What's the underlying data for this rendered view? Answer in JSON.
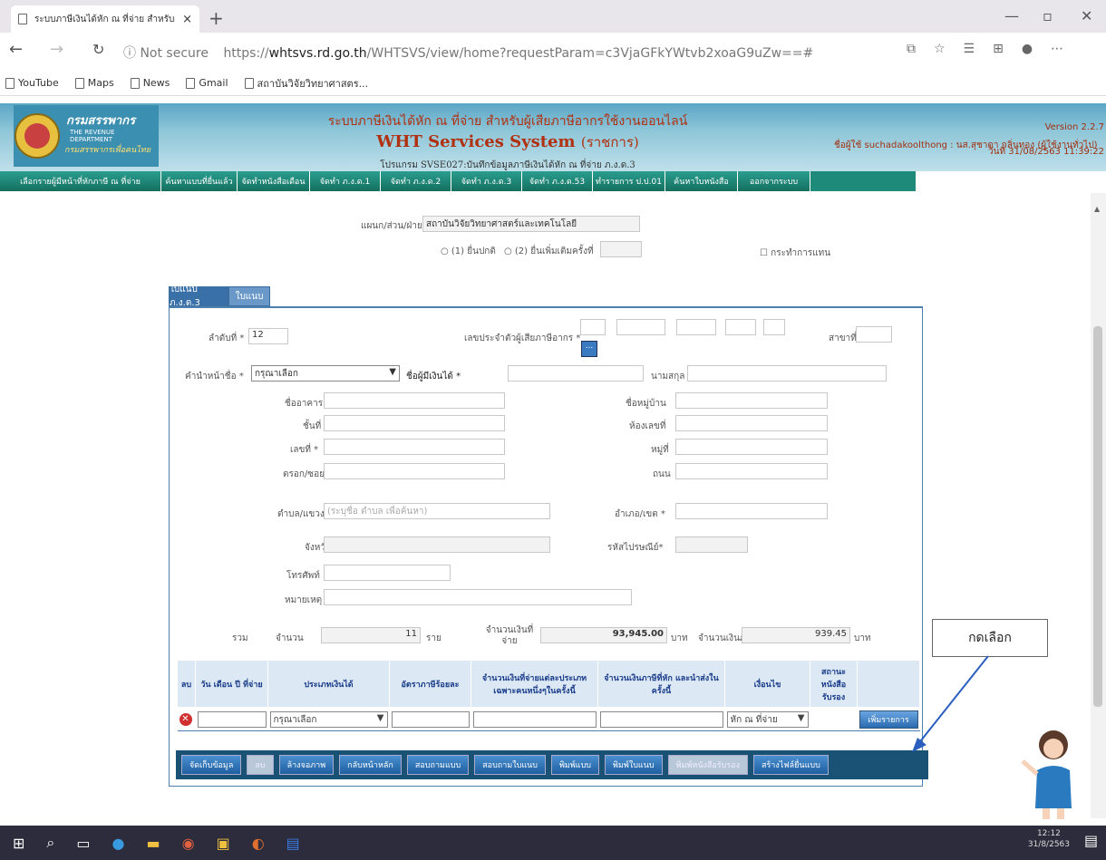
{
  "browser": {
    "tab_title": "ระบบภาษีเงินได้หัก ณ ที่จ่าย สำหรับผู้...",
    "new_tab": "+",
    "close": "×",
    "not_secure": "Not secure",
    "url_prefix": "https://",
    "url_domain": "whtsvs.rd.go.th",
    "url_rest": "/WHTSVS/view/home?requestParam=c3VjaGFkYWtvb2xoaG9uZw==#",
    "bookmarks": [
      "YouTube",
      "Maps",
      "News",
      "Gmail",
      "สถาบันวิจัยวิทยาศาสตร..."
    ]
  },
  "header": {
    "logo_text": "กรมสรรพากร",
    "logo_sub": "THE REVENUE DEPARTMENT",
    "logo_sub2": "กรมสรรพากรเพื่อคนไทย",
    "title1": "ระบบภาษีเงินได้หัก ณ ที่จ่าย สำหรับผู้เสียภาษีอากรใช้งานออนไลน์",
    "title2": "WHT Services System",
    "title2b": "(ราชการ)",
    "title3": "โปรแกรม SVSE027:บันทึกข้อมูลภาษีเงินได้หัก ณ ที่จ่าย ภ.ง.ด.3",
    "version": "Version 2.2.7",
    "user": "ชื่อผู้ใช้ suchadakoolthong : นส.สุชาดา กลิ่นทอง (ผู้ใช้งานทั่วไป)",
    "date": "วันที่ 31/08/2563 11:39:22"
  },
  "menu": [
    "เลือกรายผู้มีหน้าที่หักภาษี ณ ที่จ่าย",
    "ค้นหาแบบที่ยื่นแล้ว",
    "จัดทำหนังสือเดือน",
    "จัดทำ ภ.ง.ด.1",
    "จัดทำ ภ.ง.ด.2",
    "จัดทำ ภ.ง.ด.3",
    "จัดทำ ภ.ง.ด.53",
    "ทำรายการ ป.ป.01",
    "ค้นหาใบหนังสือ",
    "ออกจากระบบ"
  ],
  "form": {
    "dept_label": "แผนก/ส่วน/ฝ่าย",
    "dept_value": "สถาบันวิจัยวิทยาศาสตร์และเทคโนโลยี",
    "filing1": "(1) ยื่นปกติ",
    "filing2": "(2) ยื่นเพิ่มเติมครั้งที่",
    "proxy": "กระทำการแทน",
    "tab1": "ใบแนบ ภ.ง.ด.3",
    "tab2": "ใบแนบ",
    "seq_label": "ลำดับที่ *",
    "seq_value": "12",
    "taxid_label": "เลขประจำตัวผู้เสียภาษีอากร *",
    "branch_label": "สาขาที่",
    "lookup": "...",
    "prefix_label": "คำนำหน้าชื่อ *",
    "prefix_value": "กรุณาเลือก",
    "name_label": "ชื่อผู้มีเงินได้ *",
    "surname_label": "นามสกุล",
    "building": "ชื่ออาคาร",
    "village": "ชื่อหมู่บ้าน",
    "floor": "ชั้นที่",
    "room": "ห้องเลขที่",
    "number": "เลขที่ *",
    "moo": "หมู่ที่",
    "soi": "ตรอก/ซอย",
    "road": "ถนน",
    "subdistrict": "ตำบล/แขวง *",
    "subdistrict_hint": "(ระบุชื่อ ตำบล เพื่อค้นหา)",
    "district": "อำเภอ/เขต *",
    "province": "จังหวัด",
    "postcode": "รหัสไปรษณีย์*",
    "phone": "โทรศัพท์",
    "note": "หมายเหตุ",
    "total": "รวม",
    "count_label": "จำนวน",
    "count_value": "11",
    "count_unit": "ราย",
    "paid_label": "จำนวนเงินที่จ่าย",
    "paid_value": "93,945.00",
    "baht": "บาท",
    "tax_label": "จำนวนเงินภาษี",
    "tax_value": "939.45"
  },
  "grid": {
    "headers": [
      "ลบ",
      "วัน เดือน ปี ที่จ่าย",
      "ประเภทเงินได้",
      "อัตราภาษีร้อยละ",
      "จำนวนเงินที่จ่ายแต่ละประเภท เฉพาะคนหนึ่งๆในครั้งนี้",
      "จำนวนเงินภาษีที่หัก และนำส่งในครั้งนี้",
      "เงื่อนไข",
      "สถานะ หนังสือรับรอง"
    ],
    "row_type": "กรุณาเลือก",
    "row_cond": "หัก ณ ที่จ่าย",
    "add_btn": "เพิ่มรายการ"
  },
  "buttons": [
    "จัดเก็บข้อมูล",
    "ลบ",
    "ล้างจอภาพ",
    "กลับหน้าหลัก",
    "สอบถามแบบ",
    "สอบถามใบแนบ",
    "พิมพ์แบบ",
    "พิมพ์ใบแนบ",
    "พิมพ์หนังสือรับรอง",
    "สร้างไฟล์ยื่นแบบ"
  ],
  "callout": "กดเลือก",
  "clock": {
    "time": "12:12",
    "date": "31/8/2563"
  }
}
